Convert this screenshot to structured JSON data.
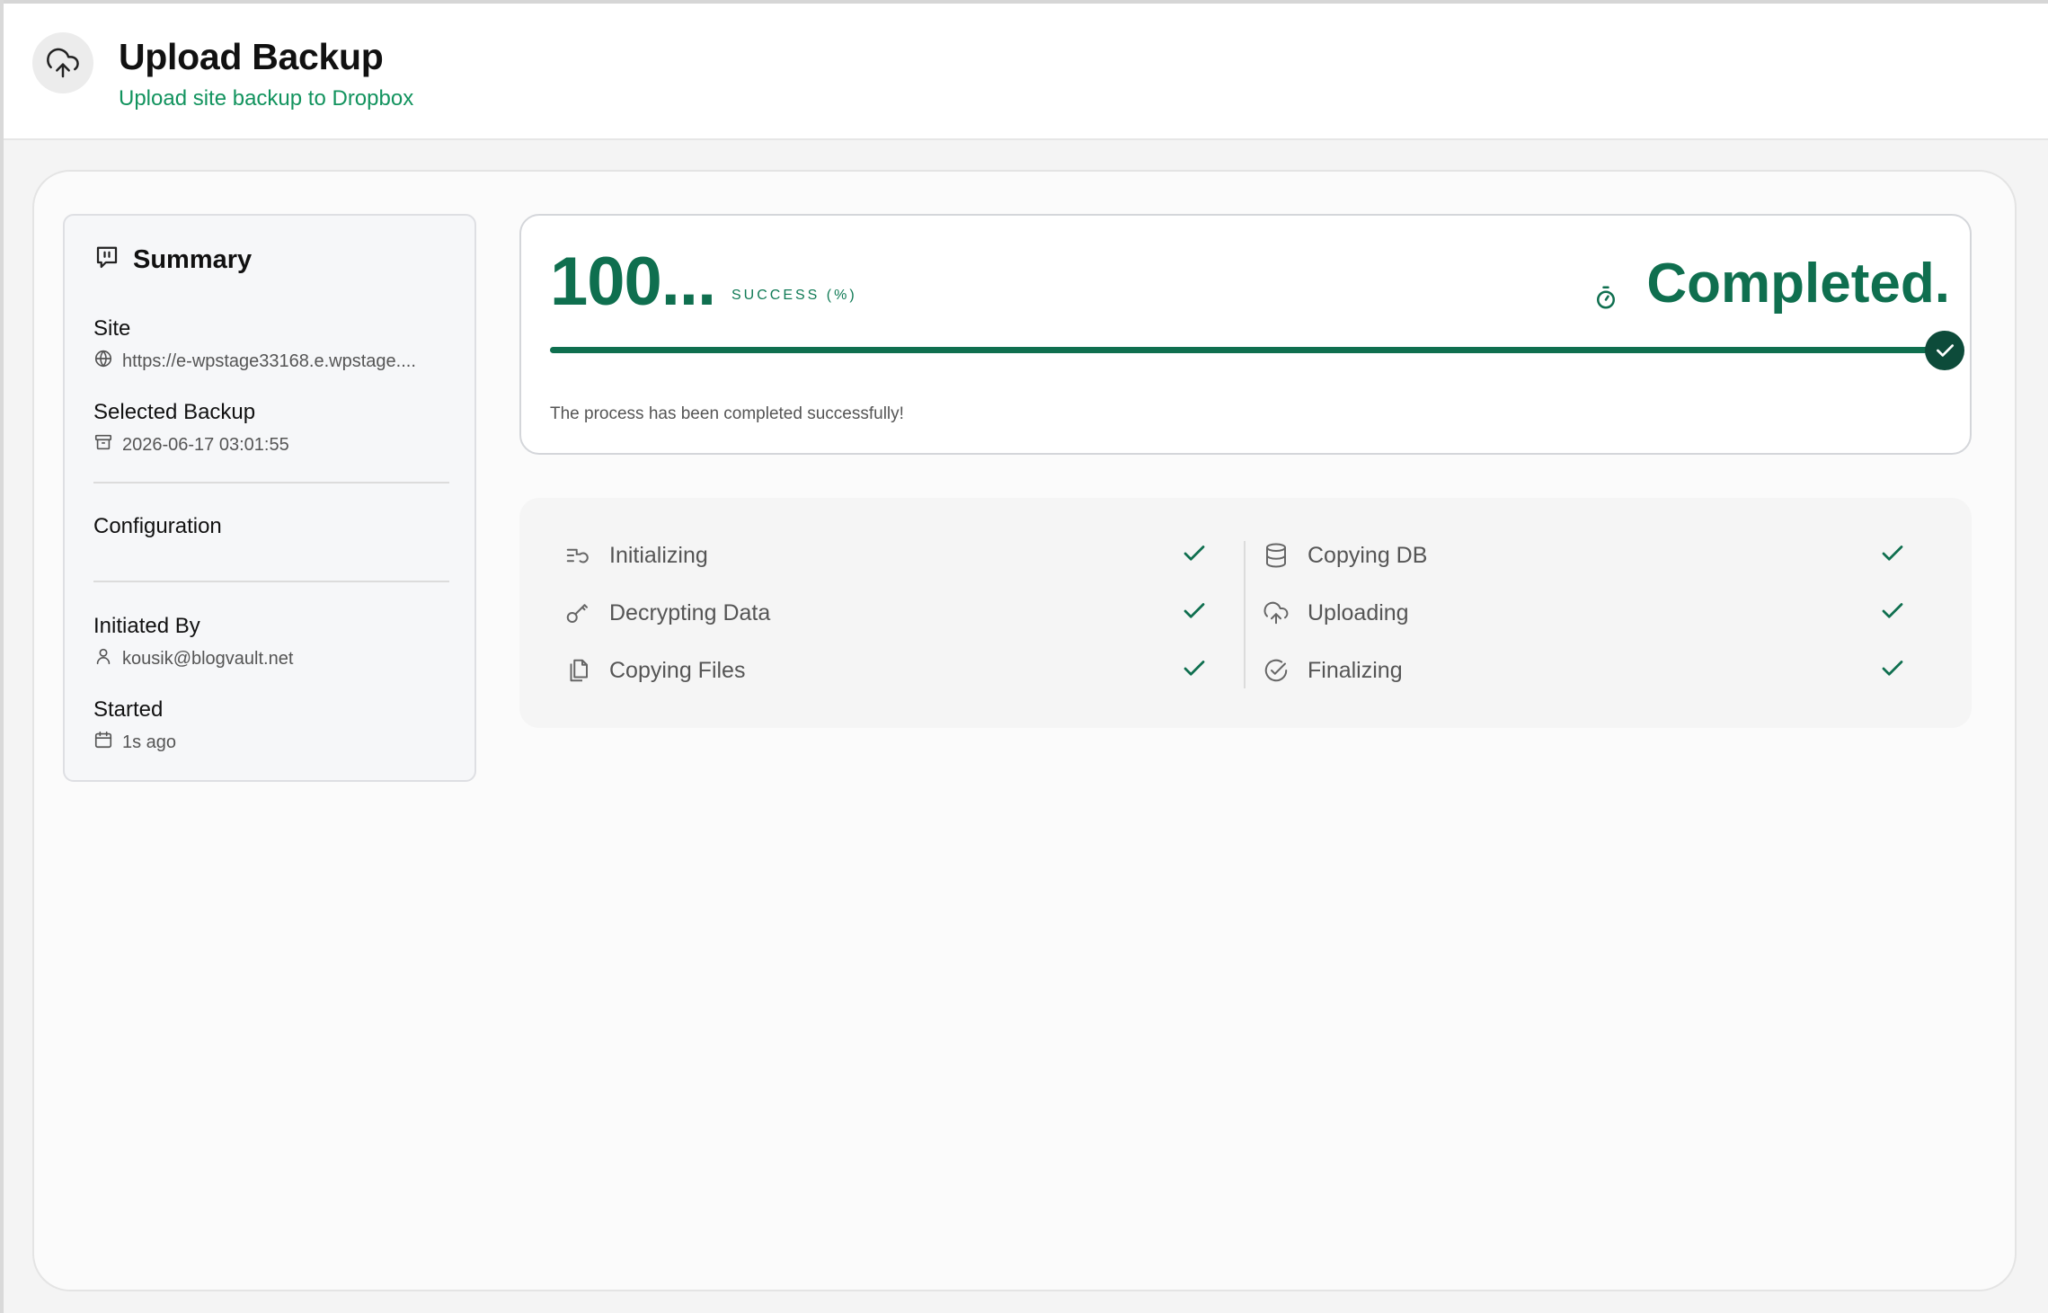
{
  "header": {
    "title": "Upload Backup",
    "subtitle": "Upload site backup to Dropbox",
    "icon": "cloud-upload-icon"
  },
  "summary": {
    "title": "Summary",
    "site_label": "Site",
    "site_value": "https://e-wpstage33168.e.wpstage....",
    "backup_label": "Selected Backup",
    "backup_value": "2026-06-17 03:01:55",
    "config_label": "Configuration",
    "initiated_label": "Initiated By",
    "initiated_value": "kousik@blogvault.net",
    "started_label": "Started",
    "started_value": "1s ago"
  },
  "progress": {
    "percent_text": "100...",
    "percent_value": 100,
    "percent_label": "SUCCESS (%)",
    "status": "Completed.",
    "message": "The process has been completed successfully!"
  },
  "steps": [
    {
      "label": "Initializing",
      "icon": "list-restart-icon",
      "done": true
    },
    {
      "label": "Decrypting Data",
      "icon": "key-icon",
      "done": true
    },
    {
      "label": "Copying Files",
      "icon": "files-icon",
      "done": true
    },
    {
      "label": "Copying DB",
      "icon": "database-icon",
      "done": true
    },
    {
      "label": "Uploading",
      "icon": "cloud-upload-icon",
      "done": true
    },
    {
      "label": "Finalizing",
      "icon": "circle-check-icon",
      "done": true
    }
  ],
  "colors": {
    "accent": "#0f6f4f",
    "subtitle_green": "#12935e",
    "knob": "#0d4b3a"
  }
}
